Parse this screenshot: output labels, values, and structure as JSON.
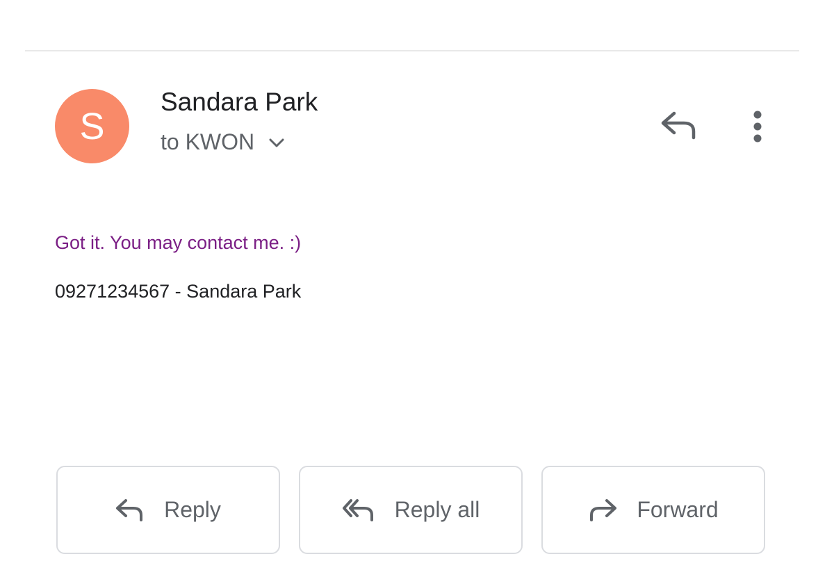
{
  "sender": {
    "avatar_letter": "S",
    "avatar_color": "#f98a69",
    "name": "Sandara Park",
    "recipients": "to KWON"
  },
  "header_actions": {
    "reply_icon": "reply-icon",
    "more_icon": "more-vert-icon"
  },
  "message": {
    "line1": "Got it. You may contact me. :)",
    "line1_color": "#7b1f85",
    "line2": "09271234567 - Sandara Park"
  },
  "actions": {
    "reply_label": "Reply",
    "reply_all_label": "Reply all",
    "forward_label": "Forward"
  },
  "colors": {
    "icon_gray": "#5f6368",
    "border": "#dadce0"
  }
}
